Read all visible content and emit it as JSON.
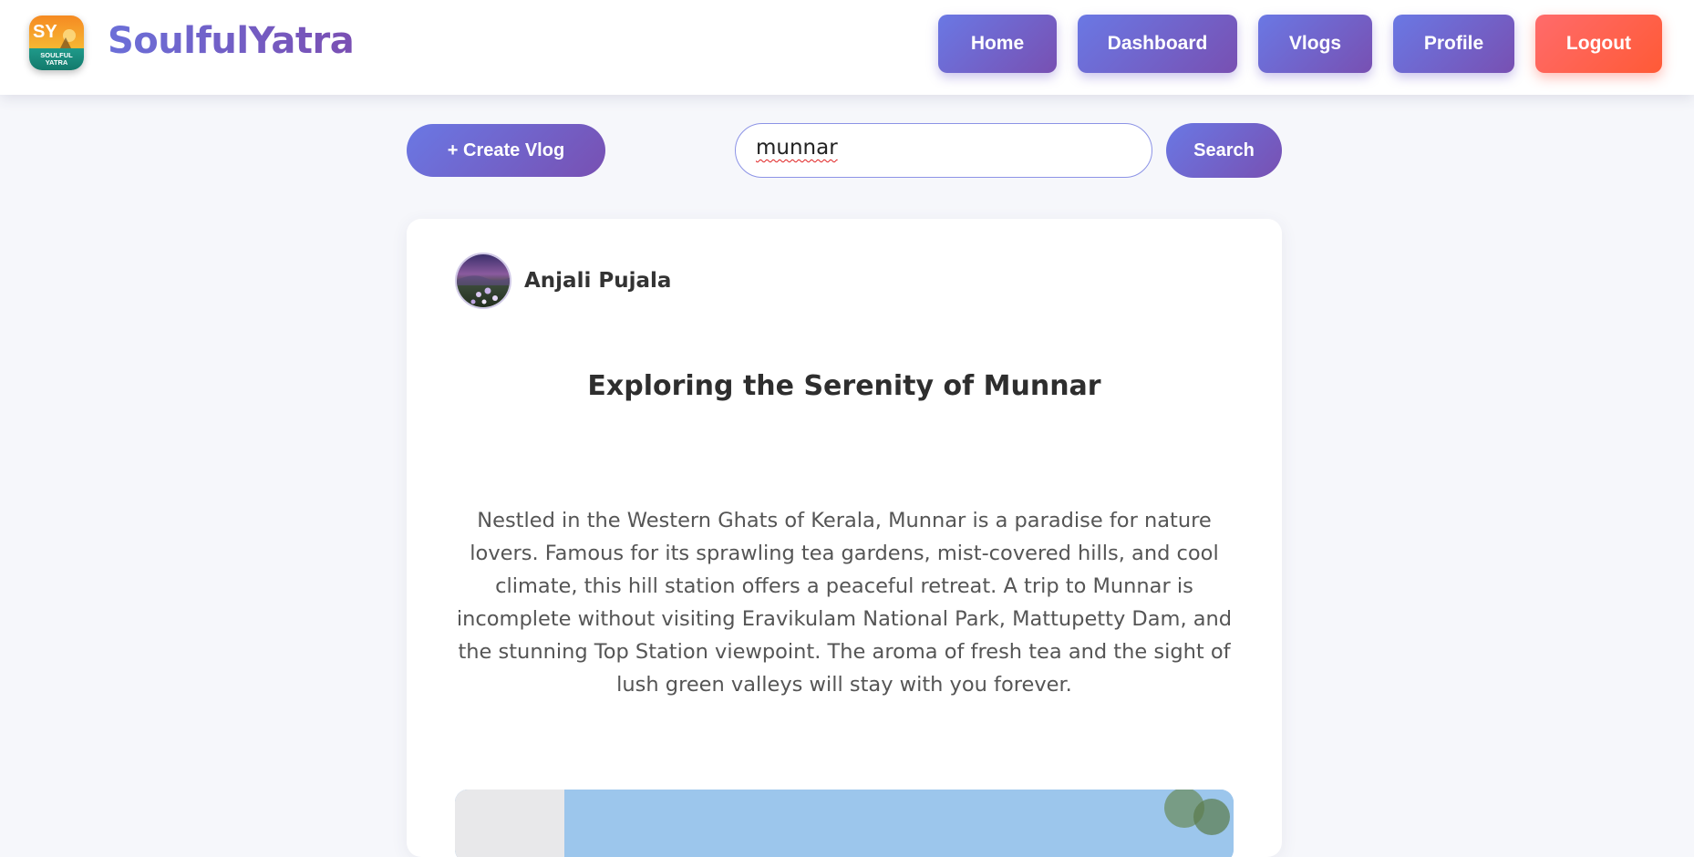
{
  "header": {
    "brand": "SoulfulYatra",
    "logo_text": "SY",
    "logo_subtext_1": "SOULFUL",
    "logo_subtext_2": "YATRA",
    "nav": {
      "home": "Home",
      "dashboard": "Dashboard",
      "vlogs": "Vlogs",
      "profile": "Profile",
      "logout": "Logout"
    }
  },
  "toolbar": {
    "create_label": "+ Create Vlog",
    "search_value": "munnar",
    "search_label": "Search"
  },
  "post": {
    "author": "Anjali Pujala",
    "title": "Exploring the Serenity of Munnar",
    "body": "Nestled in the Western Ghats of Kerala, Munnar is a paradise for nature lovers. Famous for its sprawling tea gardens, mist-covered hills, and cool climate, this hill station offers a peaceful retreat. A trip to Munnar is incomplete without visiting Eravikulam National Park, Mattupetty Dam, and the stunning Top Station viewpoint. The aroma of fresh tea and the sight of lush green valleys will stay with you forever."
  },
  "colors": {
    "accent_start": "#6a78e4",
    "accent_end": "#7850b2",
    "logout_start": "#ff6b6b",
    "logout_end": "#ff5a36",
    "background": "#f6f7fb"
  }
}
